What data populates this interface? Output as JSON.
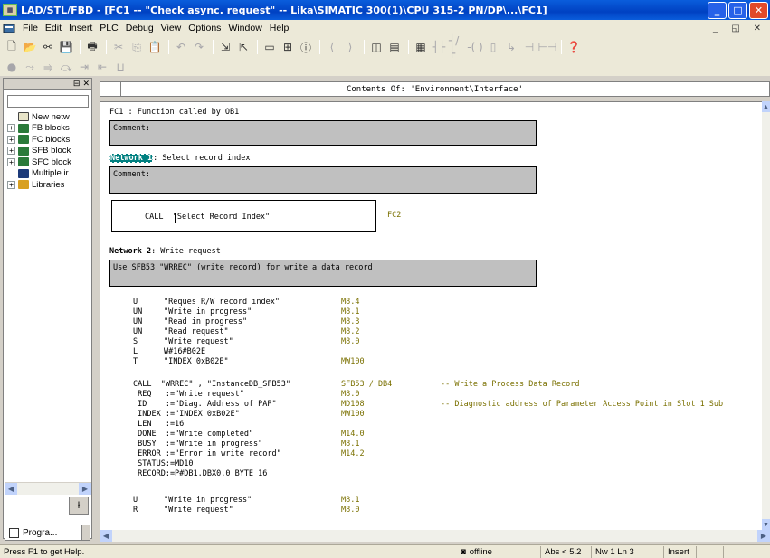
{
  "window": {
    "title": "LAD/STL/FBD  - [FC1 -- \"Check async. request\" -- Lika\\SIMATIC 300(1)\\CPU 315-2 PN/DP\\...\\FC1]",
    "min": "_",
    "max": "□",
    "close": "✕"
  },
  "menu": [
    "File",
    "Edit",
    "Insert",
    "PLC",
    "Debug",
    "View",
    "Options",
    "Window",
    "Help"
  ],
  "left_tree": [
    {
      "label": "New netw",
      "expander": ""
    },
    {
      "label": "FB blocks",
      "expander": "+"
    },
    {
      "label": "FC blocks",
      "expander": "+"
    },
    {
      "label": "SFB block",
      "expander": "+"
    },
    {
      "label": "SFC block",
      "expander": "+"
    },
    {
      "label": "Multiple ir",
      "expander": ""
    },
    {
      "label": "Libraries",
      "expander": "+"
    }
  ],
  "left_tab": {
    "label": "Progra..."
  },
  "editor": {
    "contents_of": "Contents Of: 'Environment\\Interface'",
    "block_title": "FC1 : Function called by OB1",
    "comment_label": "Comment:",
    "network1": {
      "label": "Network 1",
      "title": ": Select record index",
      "comment": "Comment:",
      "call": "CALL  \"Select Record Index\"",
      "call_addr": "FC2"
    },
    "network2": {
      "heading": "Network 2",
      "title": ": Write request",
      "comment": "Use SFB53 \"WRREC\" (write record) for write a data record",
      "lines1": [
        {
          "op": "U",
          "operand": "\"Reques R/W record index\"",
          "addr": "M8.4"
        },
        {
          "op": "UN",
          "operand": "\"Write in progress\"",
          "addr": "M8.1"
        },
        {
          "op": "UN",
          "operand": "\"Read in progress\"",
          "addr": "M8.3"
        },
        {
          "op": "UN",
          "operand": "\"Read request\"",
          "addr": "M8.2"
        },
        {
          "op": "S",
          "operand": "\"Write request\"",
          "addr": "M8.0"
        },
        {
          "op": "L",
          "operand": "W#16#B02E",
          "addr": ""
        },
        {
          "op": "T",
          "operand": "\"INDEX 0xB02E\"",
          "addr": "MW100"
        }
      ],
      "call_line": {
        "text": "CALL  \"WRREC\" , \"InstanceDB_SFB53\"",
        "addr": "SFB53 / DB4",
        "comment": "-- Write a Process Data Record"
      },
      "params": [
        {
          "text": " REQ   :=\"Write request\"",
          "addr": "M8.0",
          "comment": ""
        },
        {
          "text": " ID    :=\"Diag. Address of PAP\"",
          "addr": "MD108",
          "comment": "-- Diagnostic address of Parameter Access Point in Slot 1 Sub"
        },
        {
          "text": " INDEX :=\"INDEX 0xB02E\"",
          "addr": "MW100",
          "comment": ""
        },
        {
          "text": " LEN   :=16",
          "addr": "",
          "comment": ""
        },
        {
          "text": " DONE  :=\"Write completed\"",
          "addr": "M14.0",
          "comment": ""
        },
        {
          "text": " BUSY  :=\"Write in progress\"",
          "addr": "M8.1",
          "comment": ""
        },
        {
          "text": " ERROR :=\"Error in write record\"",
          "addr": "M14.2",
          "comment": ""
        },
        {
          "text": " STATUS:=MD10",
          "addr": "",
          "comment": ""
        },
        {
          "text": " RECORD:=P#DB1.DBX0.0 BYTE 16",
          "addr": "",
          "comment": ""
        }
      ],
      "lines2": [
        {
          "op": "U",
          "operand": "\"Write in progress\"",
          "addr": "M8.1"
        },
        {
          "op": "R",
          "operand": "\"Write request\"",
          "addr": "M8.0"
        }
      ]
    }
  },
  "status": {
    "help": "Press F1 to get Help.",
    "mode": "offline",
    "abs": "Abs < 5.2",
    "nw": "Nw 1 Ln 3",
    "insert": "Insert"
  }
}
